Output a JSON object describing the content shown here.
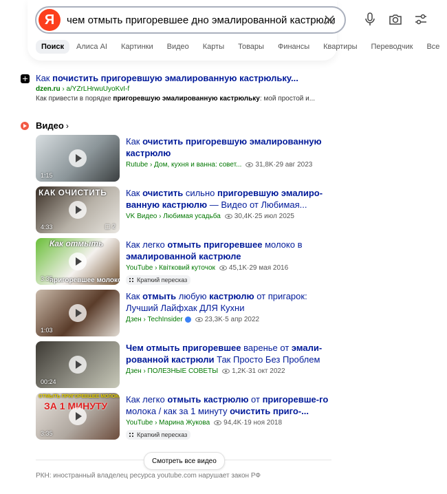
{
  "search": {
    "logo": "Я",
    "query": "чем отмыть пригоревшее дно эмалированной кастрюли"
  },
  "tabs": [
    "Поиск",
    "Алиса AI",
    "Картинки",
    "Видео",
    "Карты",
    "Товары",
    "Финансы",
    "Квартиры",
    "Переводчик",
    "Все"
  ],
  "result1": {
    "title_pre": "Как ",
    "title_bold": "почистить пригоревшую эмалированную кастрюльку...",
    "url_bold": "dzen.ru",
    "url_rest": " › a/YZrLHrwuUyoKvI-f",
    "snippet_pre": "Как привести в порядке ",
    "snippet_bold": "пригоревшую эмалированную кастрюльку",
    "snippet_post": ": мой простой и..."
  },
  "video_section": {
    "title": "Видео",
    "chevron": "›"
  },
  "videos": [
    {
      "title_parts": [
        {
          "t": "Как ",
          "b": false
        },
        {
          "t": "очистить пригоревшую эмалированную",
          "b": true
        },
        {
          "t": " ",
          "b": false
        },
        {
          "t": "кастрюлю",
          "b": true
        }
      ],
      "source": "Rutube › Дом, кухня и ванна: совет...",
      "views": "31,8K",
      "date": "29 авг 2023",
      "duration": "1:15",
      "thumb_colors": [
        "#d7dde0",
        "#8c969a",
        "#3b3f40"
      ]
    },
    {
      "title_parts": [
        {
          "t": "Как ",
          "b": false
        },
        {
          "t": "очистить",
          "b": true
        },
        {
          "t": " сильно ",
          "b": false
        },
        {
          "t": "пригоревшую эмалиро-ванную кастрюлю",
          "b": true
        },
        {
          "t": " — Видео от Любимая...",
          "b": false
        }
      ],
      "source": "VK Видео › Любимая усадьба",
      "views": "30,4K",
      "date": "25 июл 2025",
      "duration": "4:33",
      "comments": "2",
      "overlay_text": "КАК ОЧИСТИТЬ",
      "thumb_colors": [
        "#3a2f26",
        "#b7b1a7",
        "#e9e6e0"
      ]
    },
    {
      "title_parts": [
        {
          "t": "Как легко ",
          "b": false
        },
        {
          "t": "отмыть пригоревшее",
          "b": true
        },
        {
          "t": " молоко в ",
          "b": false
        },
        {
          "t": "эмалированной кастрюле",
          "b": true
        }
      ],
      "source": "YouTube › Квітковий куточок",
      "views": "45,1K",
      "date": "29 мая 2016",
      "duration": "3:35",
      "overlay_top": "Как  отмыть",
      "overlay_bottom": "пригоревшее молоко",
      "retell": "Краткий пересказ",
      "thumb_colors": [
        "#6bbf3a",
        "#f4f1ee",
        "#7a5a3a"
      ]
    },
    {
      "title_parts": [
        {
          "t": "Как ",
          "b": false
        },
        {
          "t": "отмыть",
          "b": true
        },
        {
          "t": " любую ",
          "b": false
        },
        {
          "t": "кастрюлю",
          "b": true
        },
        {
          "t": " от пригарок: Лучший Лайфхак ДЛЯ Кухни",
          "b": false
        }
      ],
      "source": "Дзен › TechInsider",
      "views": "23,3K",
      "date": "5 апр 2022",
      "duration": "1:03",
      "thumb_colors": [
        "#c9b9a9",
        "#5a3c2a",
        "#e2dcd4"
      ]
    },
    {
      "title_parts": [
        {
          "t": "Чем отмыть пригоревшее",
          "b": true
        },
        {
          "t": " варенье от ",
          "b": false
        },
        {
          "t": "эмали-рованной кастрюли",
          "b": true
        },
        {
          "t": " Так Просто Без Проблем",
          "b": false
        }
      ],
      "source": "Дзен › ПОЛЕЗНЫЕ СОВЕТЫ",
      "views": "1,2K",
      "date": "31 окт 2022",
      "duration": "00:24",
      "thumb_colors": [
        "#3d3a34",
        "#8b8a80",
        "#c8c9b9"
      ]
    },
    {
      "title_parts": [
        {
          "t": "Как легко ",
          "b": false
        },
        {
          "t": "отмыть кастрюлю",
          "b": true
        },
        {
          "t": " от ",
          "b": false
        },
        {
          "t": "пригоревше-го",
          "b": true
        },
        {
          "t": " молока / как за 1 минуту ",
          "b": false
        },
        {
          "t": "очистить приго-...",
          "b": true
        }
      ],
      "source": "YouTube › Марина Жукова",
      "views": "94,4K",
      "date": "19 ноя 2018",
      "duration": "3:35",
      "overlay_top": "ОТМЫТЬ ПРИГОРЕВШЕЕ МОЛОКО",
      "overlay_bottom": "ЗА 1 МИНУТУ",
      "retell": "Краткий пересказ",
      "thumb_colors": [
        "#e8e2dc",
        "#b0a8a0",
        "#6c4c3c"
      ]
    }
  ],
  "all_videos_button": "Смотреть все видео",
  "footer": "РКН: иностранный владелец ресурса youtube.com нарушает закон РФ"
}
